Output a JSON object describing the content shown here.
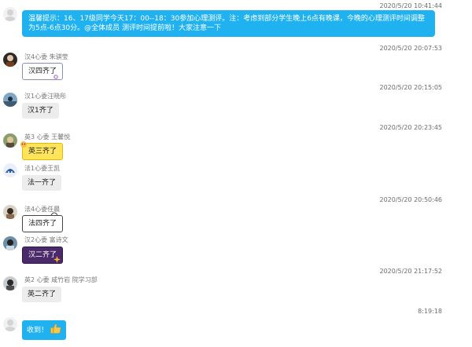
{
  "messages": [
    {
      "timestamp": "2020/5/20 10:41:44",
      "text": "温馨提示：16、17级同学今天17：00--18：30参加心理测评。注：考虑到部分学生晚上6点有晚课，今晚的心理测评时间调整为5点-6点30分。@全体成员  测评时间提前啦！大家注意一下"
    },
    {
      "timestamp": "2020/5/20 20:07:53",
      "sender": "汉4心委  朱骐莹",
      "text": "汉四齐了"
    },
    {
      "timestamp": "2020/5/20 20:15:05",
      "sender": "汉1心委汪晓彤",
      "text": "汉1齐了"
    },
    {
      "timestamp": "2020/5/20 20:23:45",
      "sender": "英3 心委 王馨悦",
      "text": "英三齐了"
    },
    {
      "sender": "法1心委王凯",
      "text": "法一齐了"
    },
    {
      "timestamp": "2020/5/20 20:50:46",
      "sender": "法4心委任晨",
      "text": "法四齐了"
    },
    {
      "sender": "汉2心委 富诗文",
      "text": "汉二齐了"
    },
    {
      "timestamp": "2020/5/20 21:17:52",
      "sender": "英2 心委 咸竹岩  院学习部",
      "text": "英二齐了"
    },
    {
      "timestamp": "8:19:18",
      "text": "收到！"
    }
  ],
  "colors": {
    "blue_bubble": "#20b2f0",
    "grey_bubble": "#ececec"
  },
  "icons": {
    "thumbs_up": "thumbs-up-icon"
  }
}
